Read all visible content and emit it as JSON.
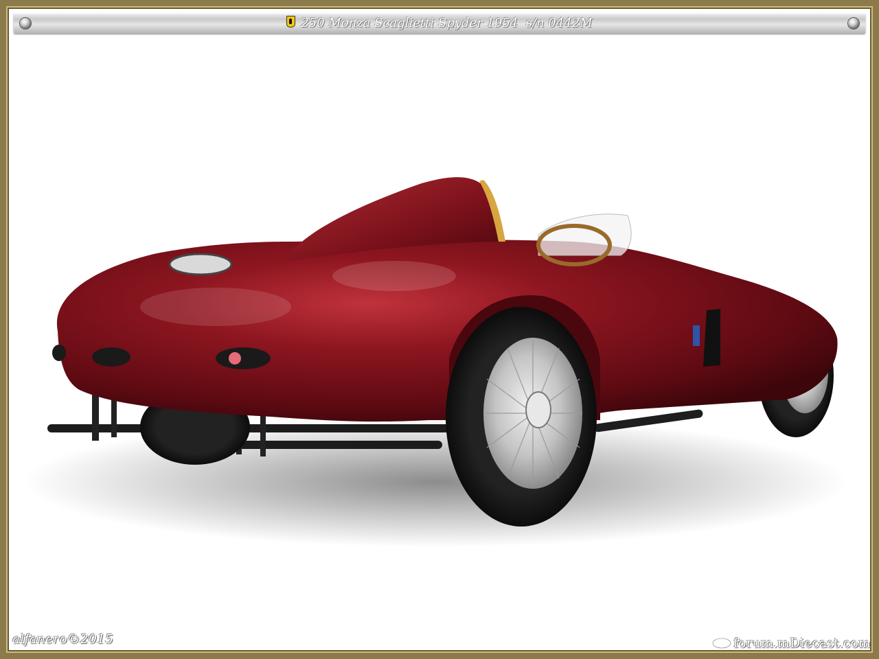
{
  "title_bar": {
    "text": "250 Monza Scaglietti Spyder 1954  s/n 0442M",
    "emblem_icon": "prancing-horse-shield-icon"
  },
  "footer": {
    "copyright": "alfanero©2015",
    "site": "forum.mDiecast.com"
  },
  "colors": {
    "frame_gold": "#8c7a4a",
    "body_red": "#7d1019",
    "background": "#ffffff"
  }
}
